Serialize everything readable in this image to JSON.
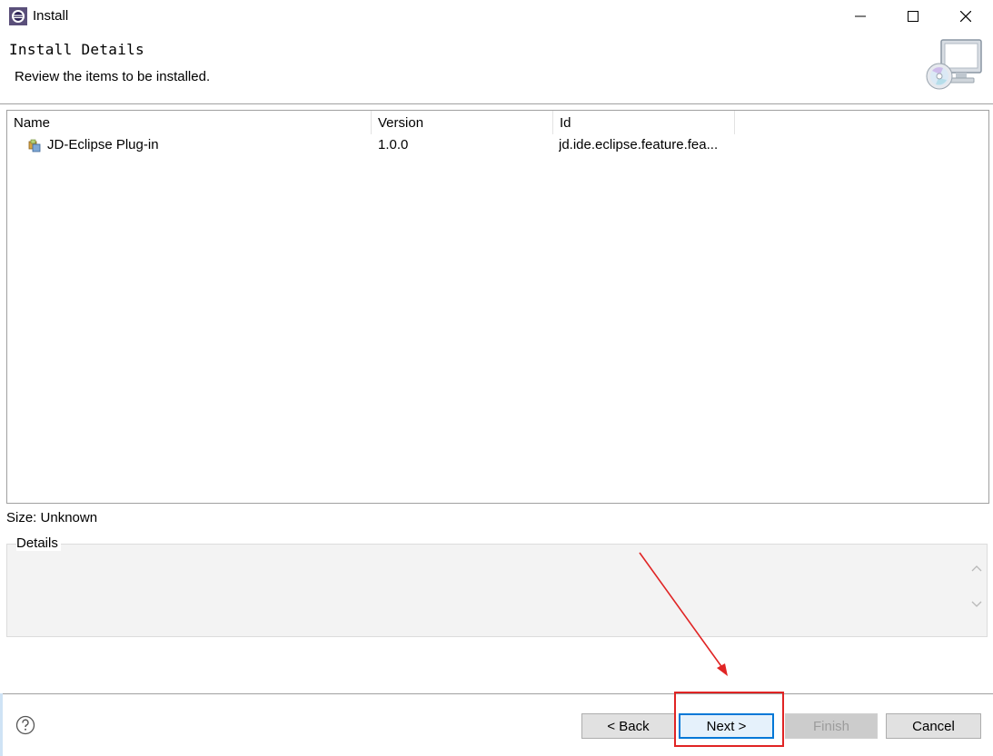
{
  "window": {
    "title": "Install"
  },
  "banner": {
    "title": "Install Details",
    "description": "Review the items to be installed."
  },
  "table": {
    "columns": [
      "Name",
      "Version",
      "Id"
    ],
    "rows": [
      {
        "name": "JD-Eclipse Plug-in",
        "version": "1.0.0",
        "id": "jd.ide.eclipse.feature.fea..."
      }
    ]
  },
  "size": {
    "label": "Size: Unknown"
  },
  "details": {
    "legend": "Details"
  },
  "buttons": {
    "back": "< Back",
    "next": "Next >",
    "finish": "Finish",
    "cancel": "Cancel"
  },
  "colors": {
    "annotation": "#e02424",
    "focus": "#0078d7",
    "border": "#a0a0a0"
  },
  "icons": {
    "app": "eclipse-icon",
    "banner": "computer-install-icon",
    "feature": "feature-icon",
    "help": "help-icon"
  }
}
